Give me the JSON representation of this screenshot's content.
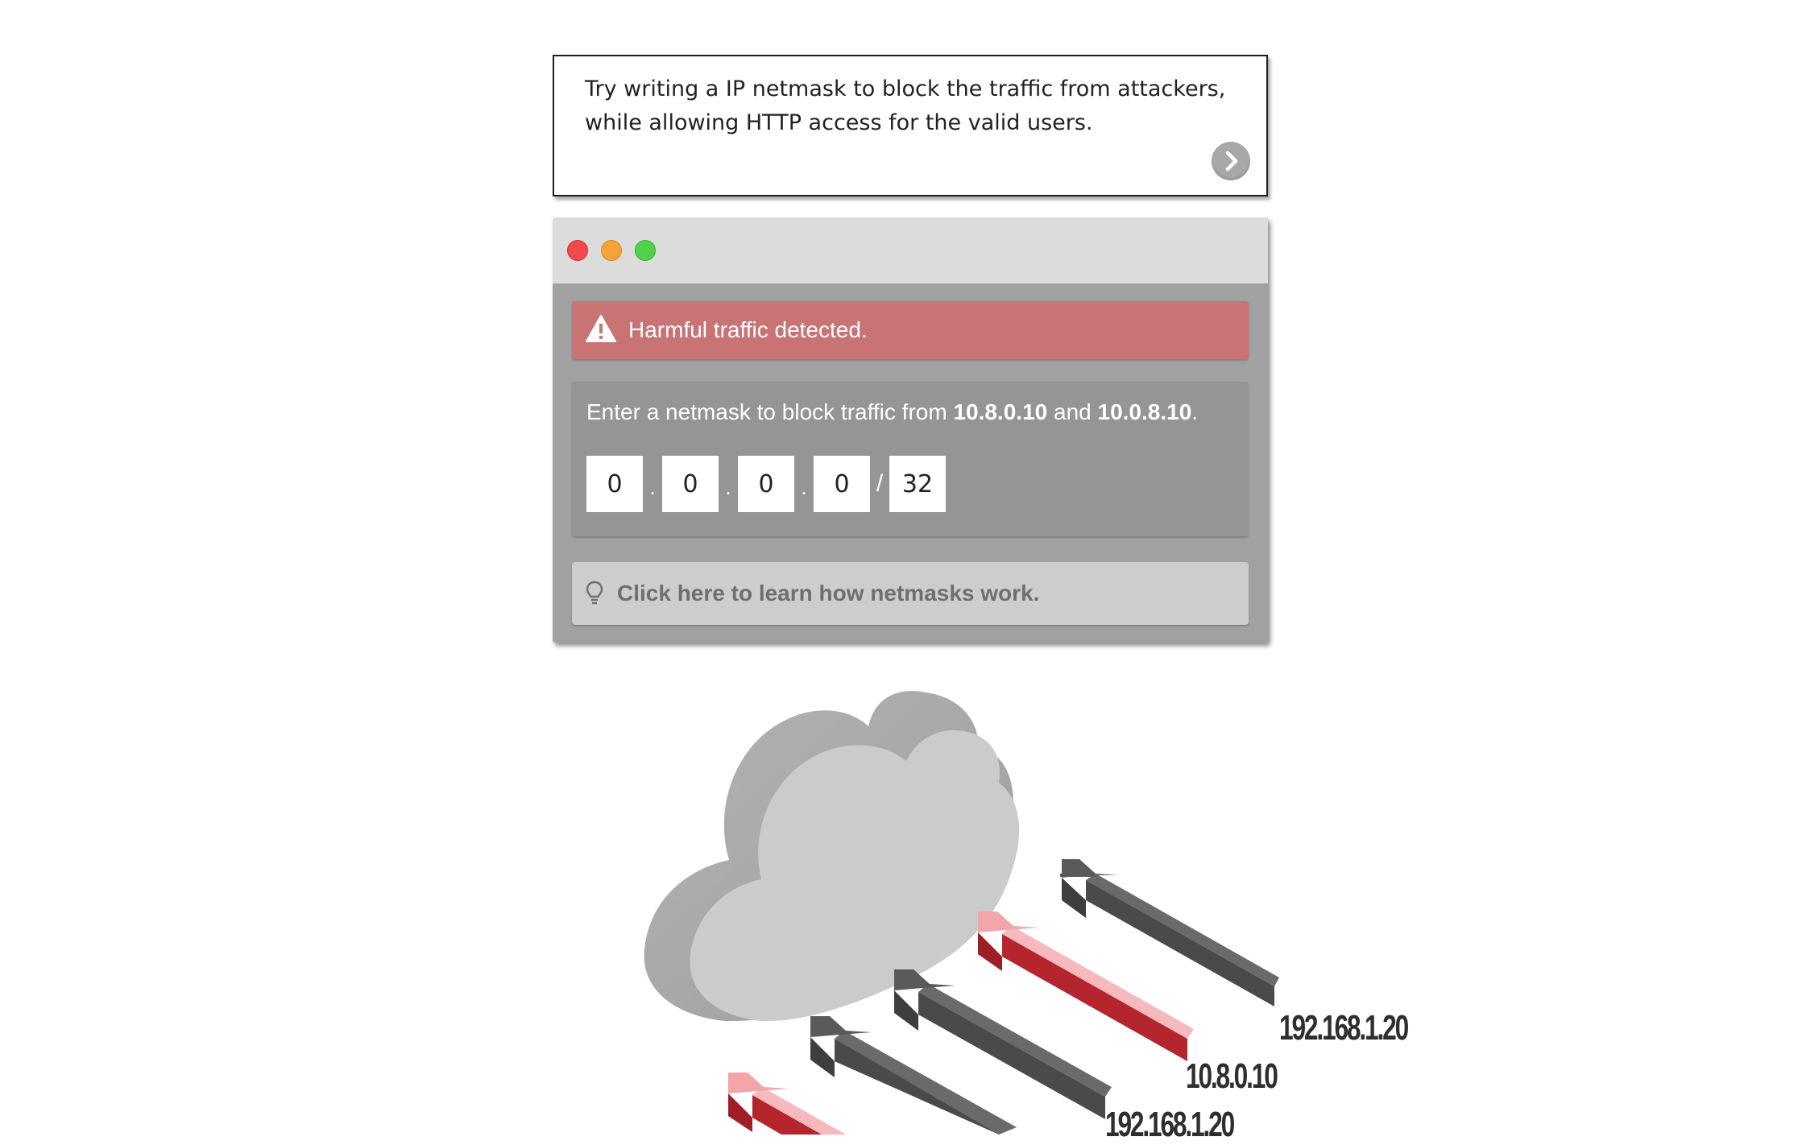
{
  "instruction": {
    "text": "Try writing a IP netmask to block the traffic from attackers, while allowing HTTP access for the valid users."
  },
  "icons": {
    "next": "chevron-right-icon",
    "alert": "warning-triangle-icon",
    "help": "lightbulb-icon"
  },
  "colors": {
    "alert_bg": "#c97375",
    "window_bg": "#a1a1a1",
    "close": "#f24a4a",
    "minimize": "#f5a238",
    "zoom": "#52d14a",
    "attack_arrow": "#f6b9bd",
    "valid_arrow": "#555555"
  },
  "alert": {
    "text": "Harmful traffic detected."
  },
  "netmask": {
    "prompt_prefix": "Enter a netmask to block traffic from ",
    "ip_a": "10.8.0.10",
    "prompt_and": " and ",
    "ip_b": "10.0.8.10",
    "prompt_suffix": ".",
    "octets": [
      "0",
      "0",
      "0",
      "0"
    ],
    "separator_dot": ".",
    "separator_slash": "/",
    "prefix": "32"
  },
  "help": {
    "text": "Click here to learn how netmasks work."
  },
  "traffic_labels": [
    "192.168.1.20",
    "10.8.0.10",
    "192.168.1.20"
  ]
}
